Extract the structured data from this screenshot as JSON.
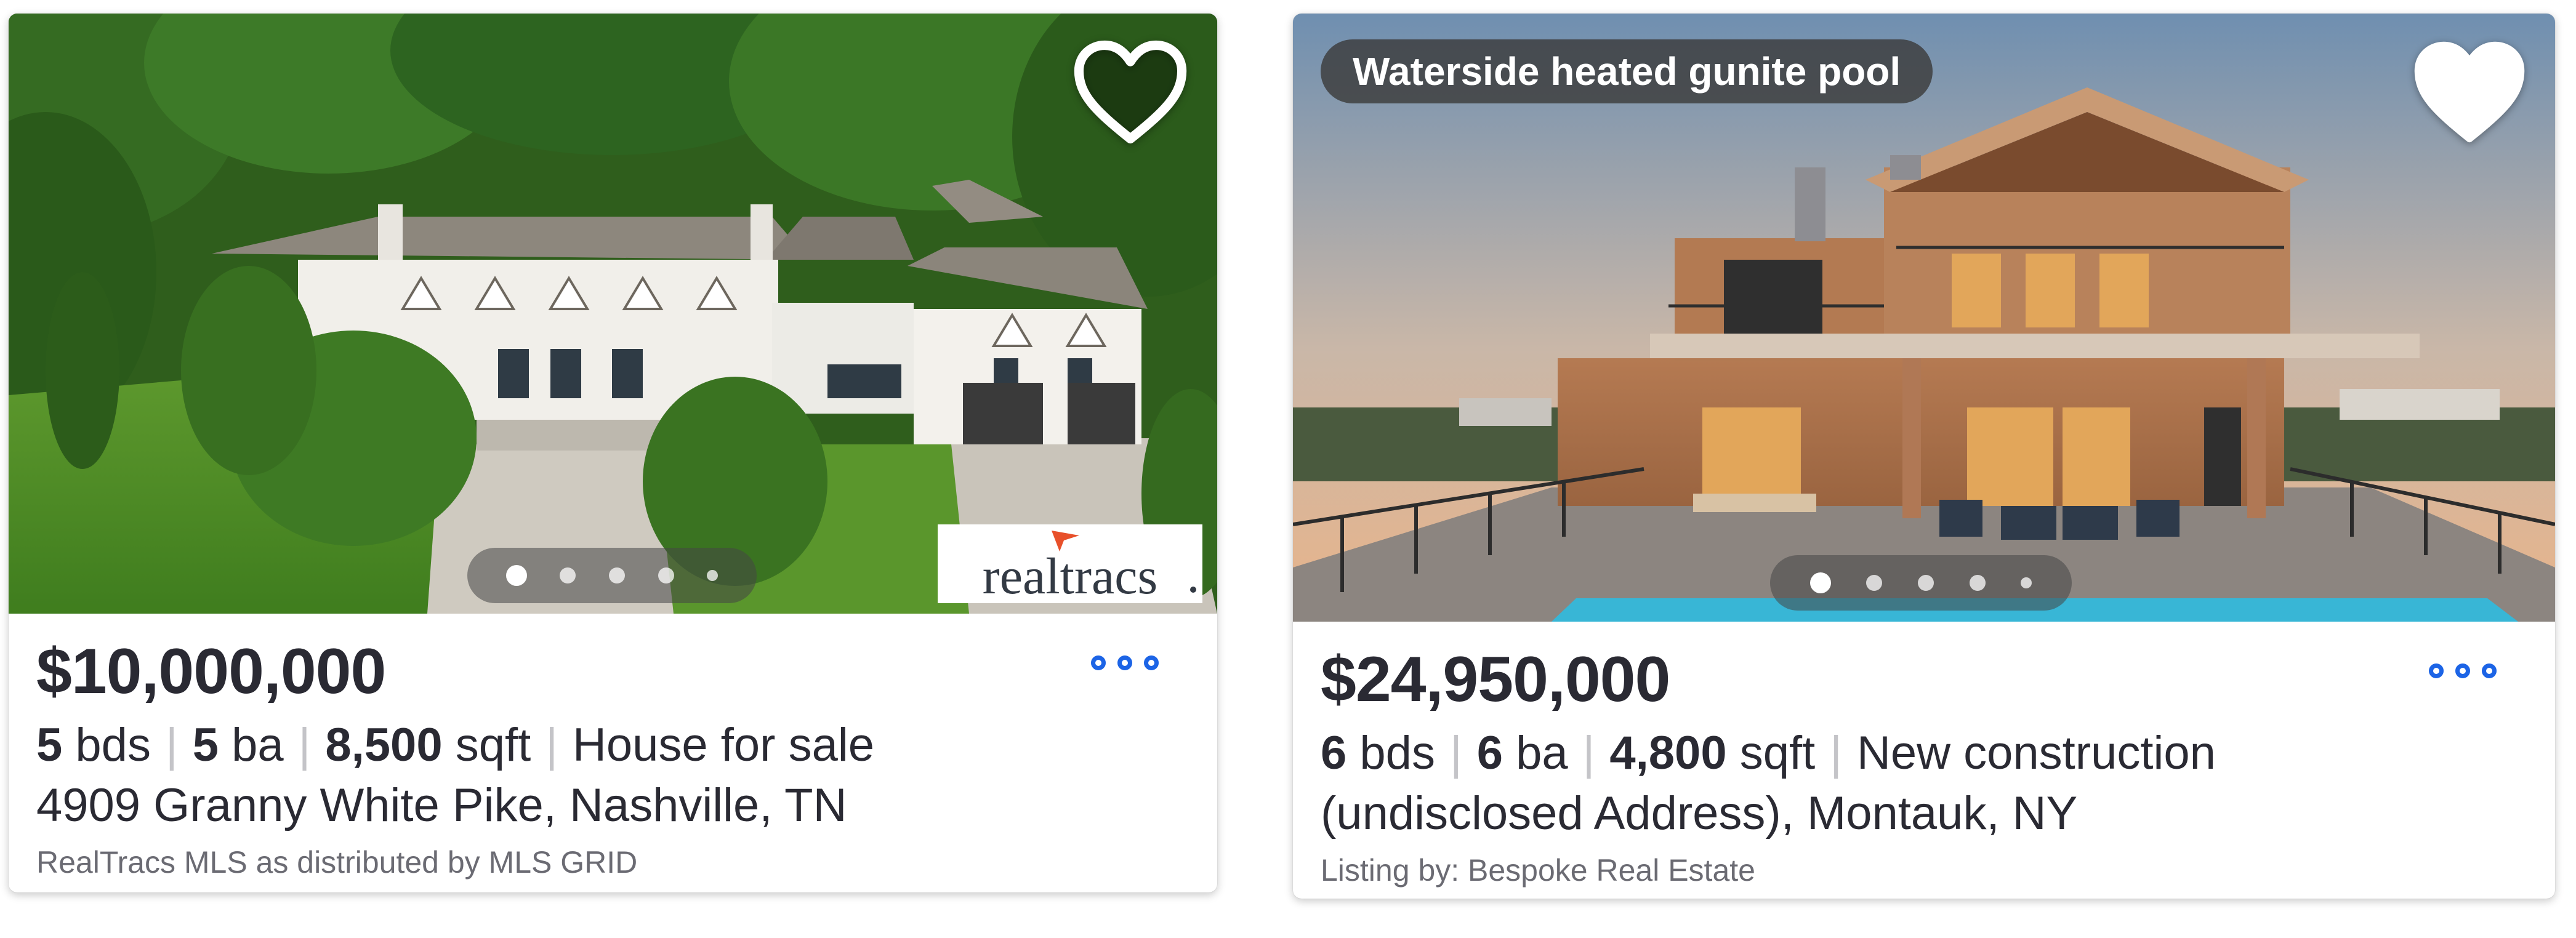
{
  "listings": [
    {
      "image_alt": "",
      "badge": "",
      "price": "$10,000,000",
      "beds": "5",
      "beds_unit": "bds",
      "baths": "5",
      "baths_unit": "ba",
      "sqft": "8,500",
      "sqft_unit": "sqft",
      "status": "House for sale",
      "address": "4909 Granny White Pike, Nashville, TN",
      "attribution": "RealTracs MLS as distributed by MLS GRID",
      "broker_logo_text": "realtracs",
      "photo_index": 1,
      "photo_count": 5,
      "saved": false
    },
    {
      "badge": "Waterside heated gunite pool",
      "price": "$24,950,000",
      "beds": "6",
      "beds_unit": "bds",
      "baths": "6",
      "baths_unit": "ba",
      "sqft": "4,800",
      "sqft_unit": "sqft",
      "status": "New construction",
      "address": "(undisclosed Address), Montauk, NY",
      "attribution": "Listing by: Bespoke Real Estate",
      "photo_index": 1,
      "photo_count": 5,
      "saved": false
    }
  ],
  "icons": {
    "favorite": "heart-icon",
    "more": "more-options-icon"
  },
  "colors": {
    "accent_blue": "#1c64e6",
    "text_primary": "#2a2a33",
    "text_secondary": "#6b6b73",
    "logo_orange": "#e8502a"
  }
}
